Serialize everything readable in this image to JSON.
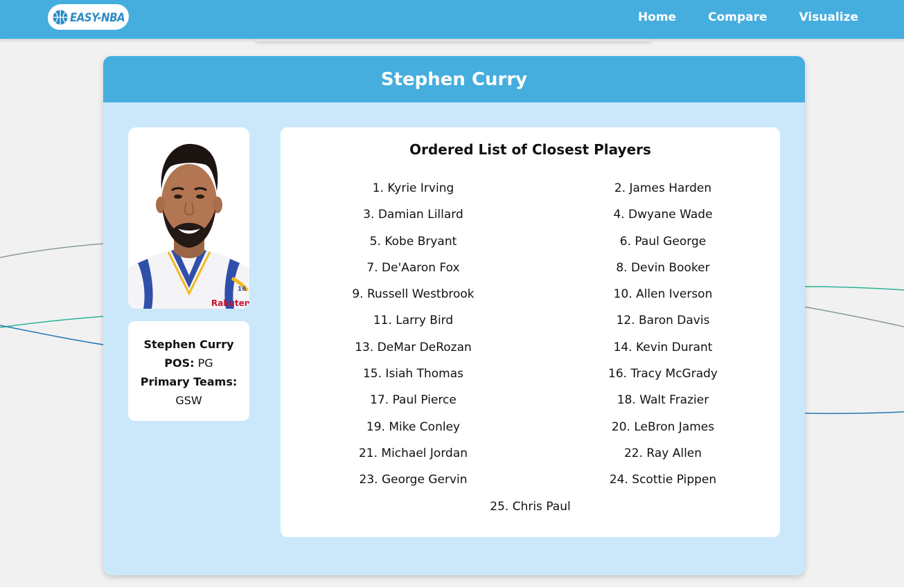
{
  "nav": {
    "logo_text": "EASY-NBA",
    "logo_icon": "basketball-icon",
    "links": [
      "Home",
      "Compare",
      "Visualize"
    ]
  },
  "player": {
    "name": "Stephen Curry",
    "pos_label": "POS:",
    "pos": "PG",
    "teams_label": "Primary Teams:",
    "teams": "GSW",
    "photo": "player-headshot"
  },
  "closest": {
    "title": "Ordered List of Closest Players",
    "items": [
      "1. Kyrie Irving",
      "2. James Harden",
      "3. Damian Lillard",
      "4. Dwyane Wade",
      "5. Kobe Bryant",
      "6. Paul George",
      "7. De'Aaron Fox",
      "8. Devin Booker",
      "9. Russell Westbrook",
      "10. Allen Iverson",
      "11. Larry Bird",
      "12. Baron Davis",
      "13. DeMar DeRozan",
      "14. Kevin Durant",
      "15. Isiah Thomas",
      "16. Tracy McGrady",
      "17. Paul Pierce",
      "18. Walt Frazier",
      "19. Mike Conley",
      "20. LeBron James",
      "21. Michael Jordan",
      "22. Ray Allen",
      "23. George Gervin",
      "24. Scottie Pippen",
      "25. Chris Paul"
    ]
  },
  "colors": {
    "primary": "#45aede",
    "card_bg": "#cbe8fb",
    "page_bg": "#f1f1f1",
    "line_teal": "#27b394",
    "line_blue": "#1f78b4",
    "line_gray": "#8a9a9a"
  }
}
